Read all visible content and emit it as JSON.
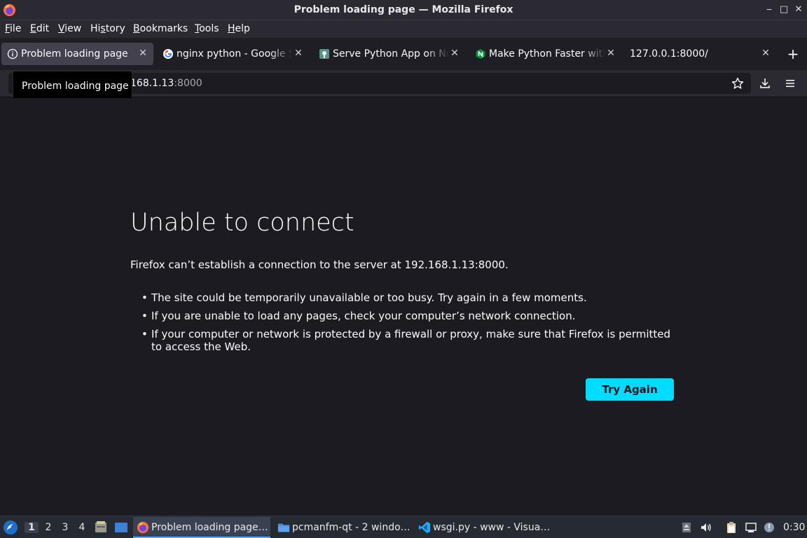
{
  "window": {
    "title": "Problem loading page — Mozilla Firefox",
    "minimize": "‒",
    "maximize": "□",
    "close": "✕"
  },
  "menu": [
    {
      "label": "File",
      "accel": "F",
      "rest": "ile"
    },
    {
      "label": "Edit",
      "accel": "E",
      "rest": "dit"
    },
    {
      "label": "View",
      "accel": "V",
      "rest": "iew"
    },
    {
      "label": "History",
      "pre": "Hi",
      "accel": "s",
      "rest": "tory"
    },
    {
      "label": "Bookmarks",
      "accel": "B",
      "rest": "ookmarks"
    },
    {
      "label": "Tools",
      "accel": "T",
      "rest": "ools"
    },
    {
      "label": "Help",
      "accel": "H",
      "rest": "elp"
    }
  ],
  "tabs": [
    {
      "label": "Problem loading page",
      "icon": "info-icon"
    },
    {
      "label": "nginx python - Google Search",
      "icon": "google-icon"
    },
    {
      "label": "Serve Python App on Nginx",
      "icon": "site-icon"
    },
    {
      "label": "Make Python Faster with",
      "icon": "nginx-icon"
    },
    {
      "label": "127.0.0.1:8000/",
      "icon": ""
    }
  ],
  "tooltip": "Problem loading page",
  "urlbar": {
    "host": "168.1.13",
    "port": ":8000"
  },
  "error": {
    "title": "Unable to connect",
    "description": "Firefox can’t establish a connection to the server at 192.168.1.13:8000.",
    "bullets": [
      "The site could be temporarily unavailable or too busy. Try again in a few moments.",
      "If you are unable to load any pages, check your computer’s network connection.",
      "If your computer or network is protected by a firewall or proxy, make sure that Firefox is permitted to access the Web."
    ],
    "button": "Try Again"
  },
  "taskbar": {
    "desktops": [
      "1",
      "2",
      "3",
      "4"
    ],
    "tasks": [
      {
        "label": "Problem loading page…",
        "icon": "firefox-icon"
      },
      {
        "label": "pcmanfm-qt - 2 windo…",
        "icon": "folder-icon"
      },
      {
        "label": "wsgi.py - www - Visua…",
        "icon": "vscode-icon"
      }
    ],
    "clock": "0:30"
  },
  "colors": {
    "accent": "#00ddff",
    "background": "#1c1b22",
    "toolbar": "#2b2a33"
  }
}
